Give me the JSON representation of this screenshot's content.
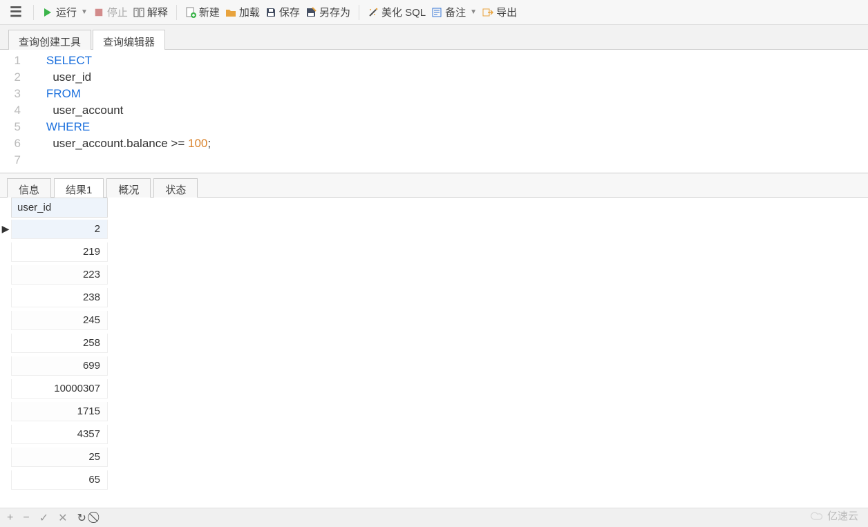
{
  "toolbar": {
    "run": "运行",
    "stop": "停止",
    "explain": "解释",
    "new": "新建",
    "load": "加载",
    "save": "保存",
    "save_as": "另存为",
    "beautify": "美化 SQL",
    "notes": "备注",
    "export": "导出"
  },
  "top_tabs": {
    "builder": "查询创建工具",
    "editor": "查询编辑器"
  },
  "sql": {
    "lines": [
      "1",
      "2",
      "3",
      "4",
      "5",
      "6",
      "7"
    ],
    "kw_select": "SELECT",
    "col": "user_id",
    "kw_from": "FROM",
    "table": "user_account",
    "kw_where": "WHERE",
    "cond_left": "user_account.balance >= ",
    "cond_num": "100",
    "cond_end": ";"
  },
  "bottom_tabs": {
    "info": "信息",
    "result": "结果1",
    "profile": "概况",
    "status": "状态"
  },
  "results": {
    "column": "user_id",
    "rows": [
      "2",
      "219",
      "223",
      "238",
      "245",
      "258",
      "699",
      "10000307",
      "1715",
      "4357",
      "25",
      "65"
    ]
  },
  "watermark": "亿速云"
}
